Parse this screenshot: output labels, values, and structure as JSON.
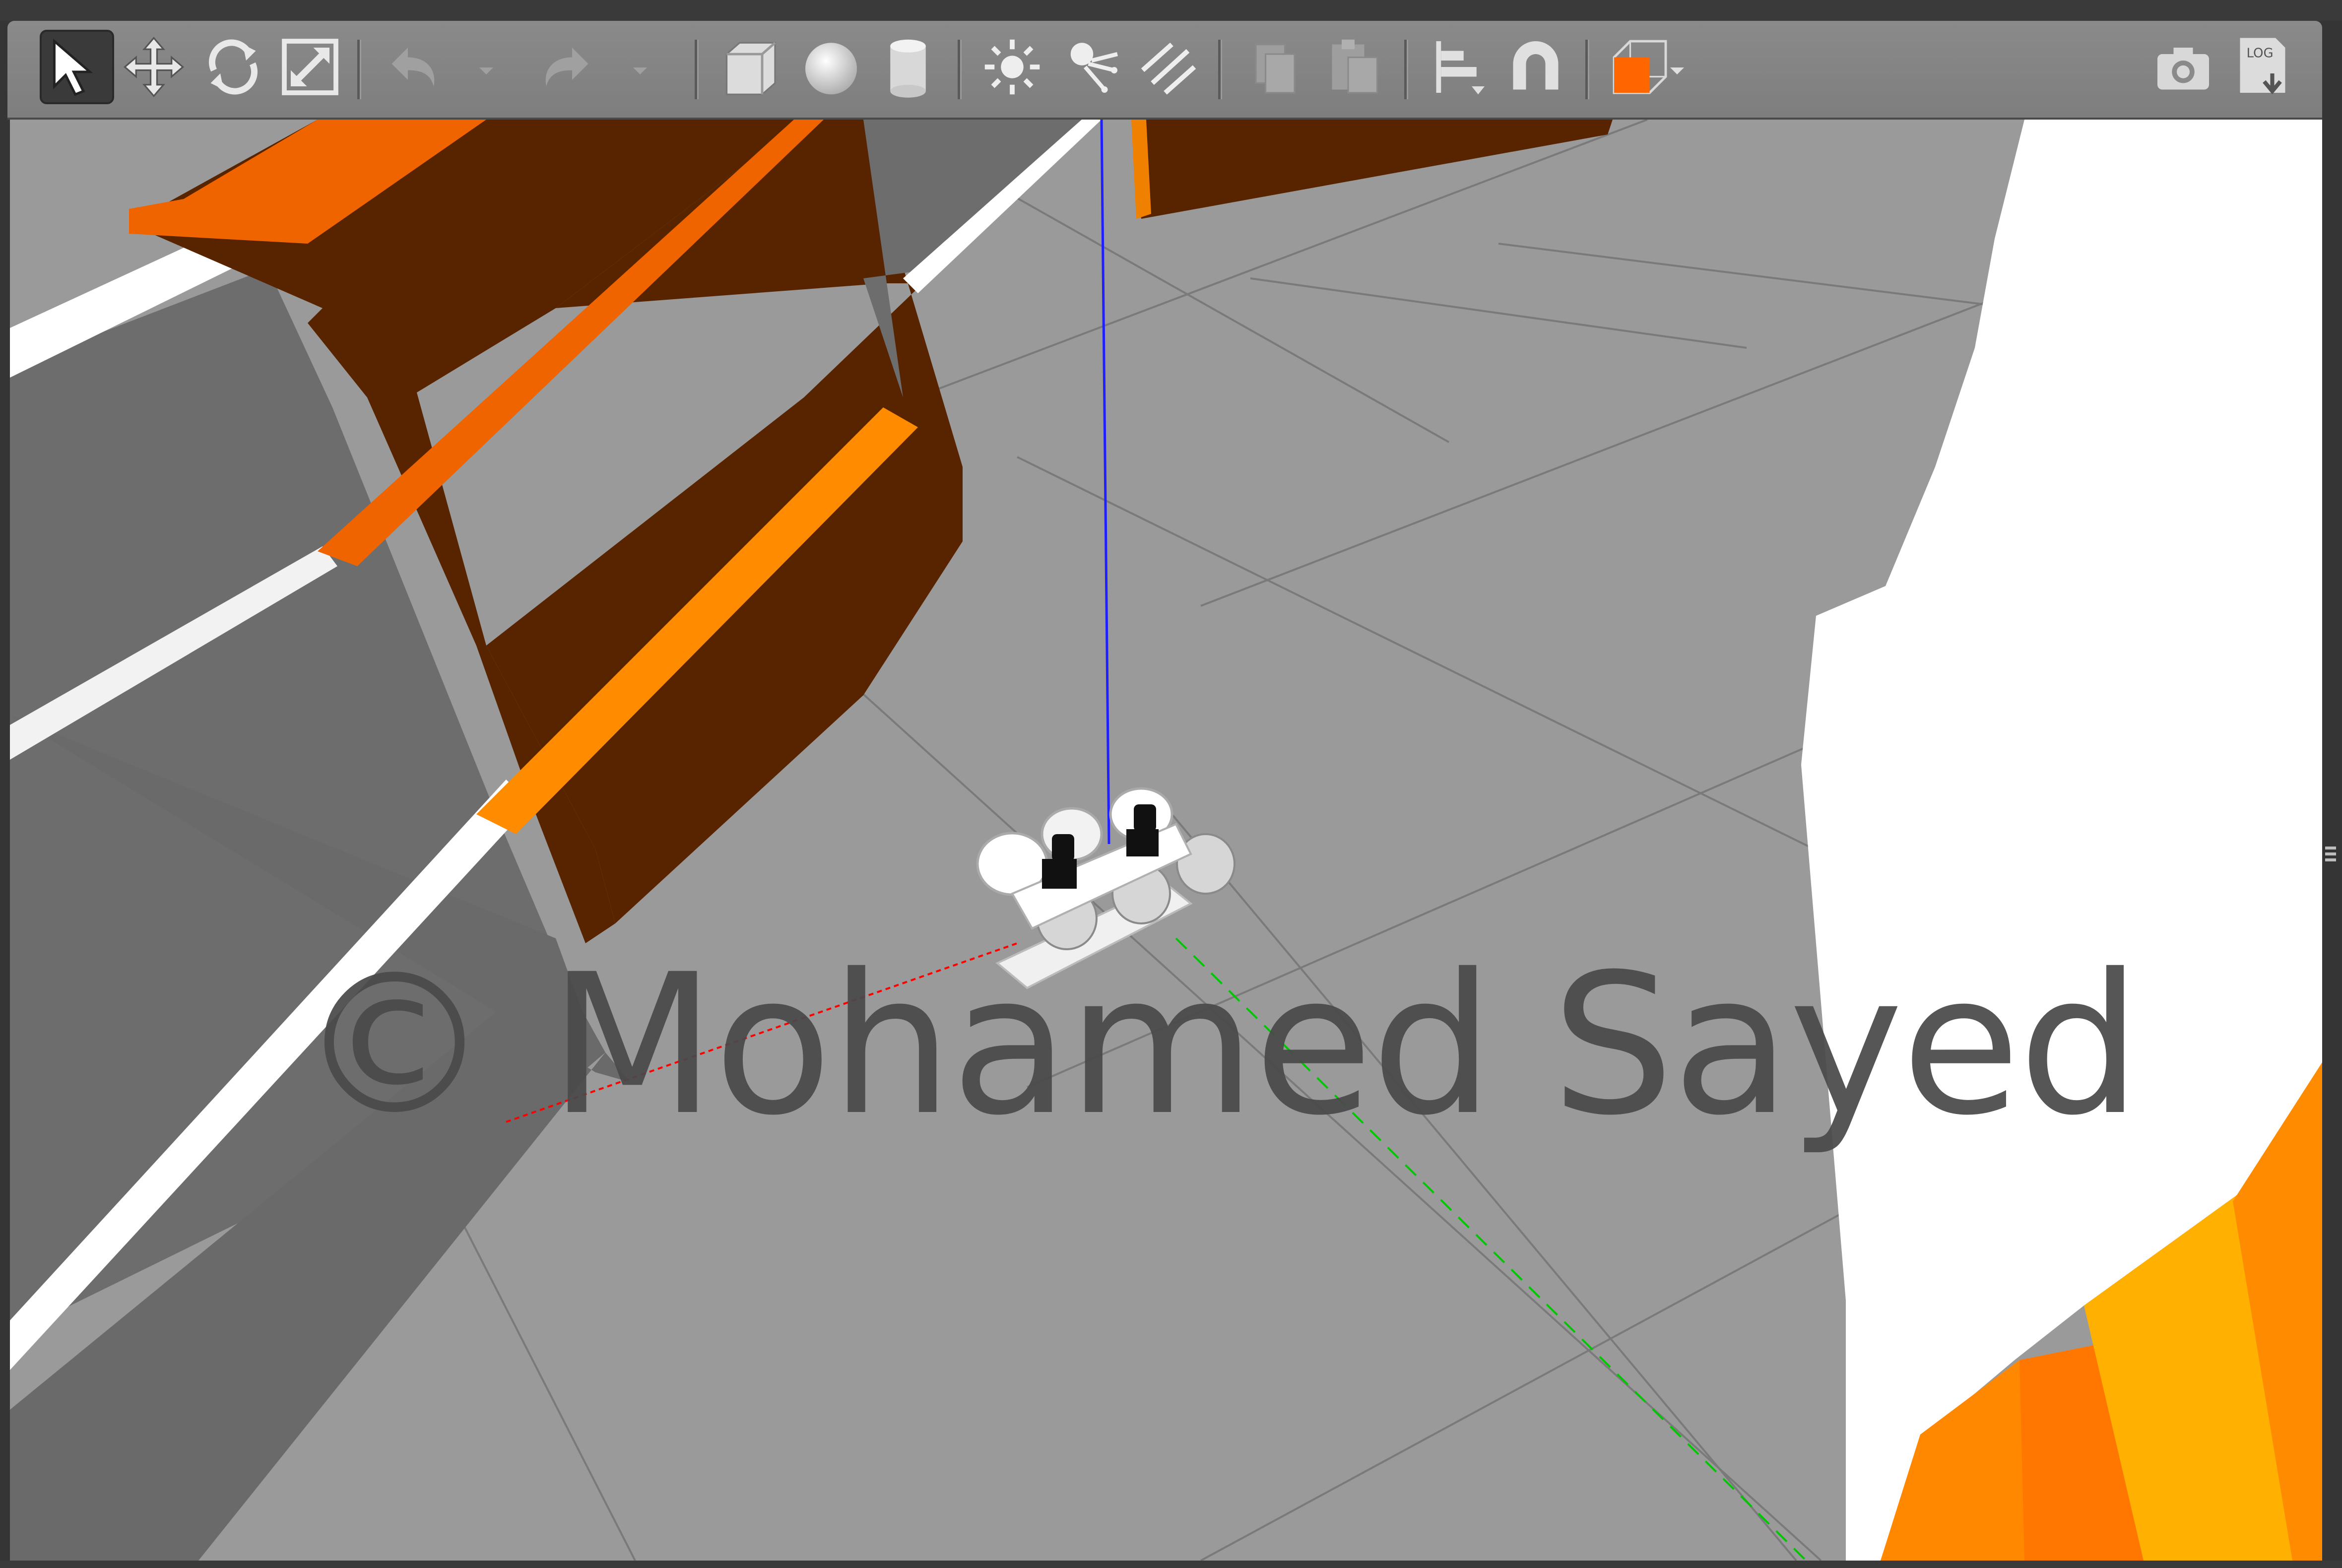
{
  "window": {
    "title": ""
  },
  "toolbar": {
    "tools": [
      {
        "name": "select-mode-button",
        "icon": "arrow-pointer-icon",
        "active": true
      },
      {
        "name": "translate-mode-button",
        "icon": "move-arrows-icon"
      },
      {
        "name": "rotate-mode-button",
        "icon": "rotate-icon"
      },
      {
        "name": "scale-mode-button",
        "icon": "scale-icon"
      },
      {
        "name": "undo-button",
        "icon": "undo-icon"
      },
      {
        "name": "redo-button",
        "icon": "redo-icon"
      },
      {
        "name": "box-shape-button",
        "icon": "box-icon"
      },
      {
        "name": "sphere-shape-button",
        "icon": "sphere-icon"
      },
      {
        "name": "cylinder-shape-button",
        "icon": "cylinder-icon"
      },
      {
        "name": "point-light-button",
        "icon": "point-light-icon"
      },
      {
        "name": "spot-light-button",
        "icon": "spot-light-icon"
      },
      {
        "name": "directional-light-button",
        "icon": "directional-light-icon"
      },
      {
        "name": "copy-button",
        "icon": "copy-icon"
      },
      {
        "name": "paste-button",
        "icon": "paste-icon"
      },
      {
        "name": "align-button",
        "icon": "align-icon"
      },
      {
        "name": "snap-button",
        "icon": "magnet-icon"
      },
      {
        "name": "view-angle-button",
        "icon": "view-cube-icon"
      },
      {
        "name": "screenshot-button",
        "icon": "camera-icon"
      },
      {
        "name": "log-button",
        "icon": "log-icon"
      }
    ],
    "log_label": "LOG"
  },
  "watermark": {
    "text": "© Mohamed Sayed"
  },
  "colors": {
    "ground": "#9a9a9a",
    "wall_dark": "#582400",
    "wall_orange": "#f06400",
    "wall_highlight": "#ff8c00",
    "wall_gray": "#6e6e6e",
    "white_surface": "#ffffff",
    "yellow": "#ffb000",
    "axis_x": "#ff0000",
    "axis_y": "#00c800",
    "axis_z": "#2020ff"
  }
}
